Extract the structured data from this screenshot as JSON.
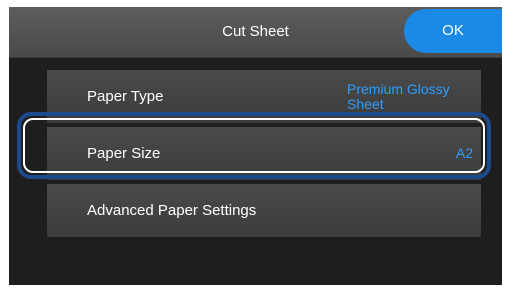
{
  "header": {
    "title": "Cut Sheet",
    "ok_label": "OK"
  },
  "settings": {
    "items": [
      {
        "label": "Paper Type",
        "value": "Premium Glossy Sheet"
      },
      {
        "label": "Paper Size",
        "value": "A2"
      },
      {
        "label": "Advanced Paper Settings",
        "value": ""
      }
    ]
  },
  "colors": {
    "accent": "#1a8ae6",
    "value_text": "#2f9cff",
    "highlight_ring": "#1c4a8f"
  }
}
